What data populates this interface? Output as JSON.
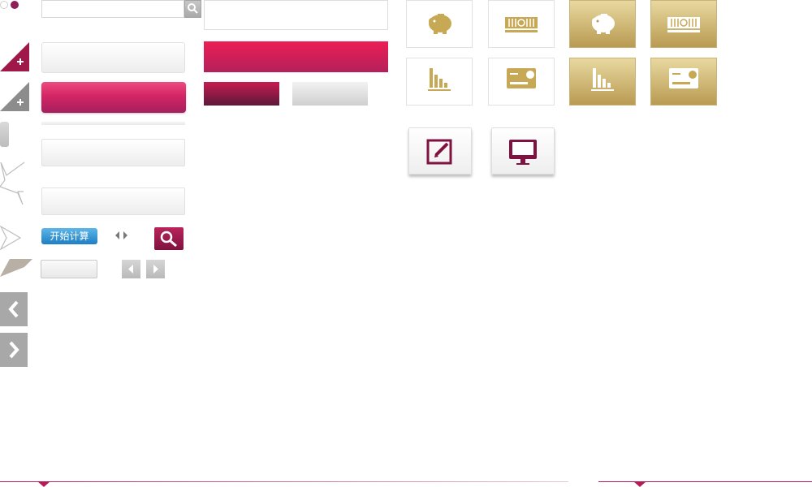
{
  "search": {
    "value": ""
  },
  "calc_button_label": "开始计算",
  "colors": {
    "accent": "#b51b58",
    "gold": "#c7a955",
    "gray": "#a8a8a8",
    "blue": "#2f8fd3"
  },
  "icons": {
    "row1": [
      "piggy-bank-icon",
      "cash-stack-icon",
      "piggy-bank-icon",
      "cash-stack-icon"
    ],
    "row2": [
      "bar-chart-icon",
      "credit-card-icon",
      "bar-chart-icon",
      "credit-card-icon"
    ],
    "large": [
      "edit-icon",
      "monitor-icon"
    ]
  }
}
